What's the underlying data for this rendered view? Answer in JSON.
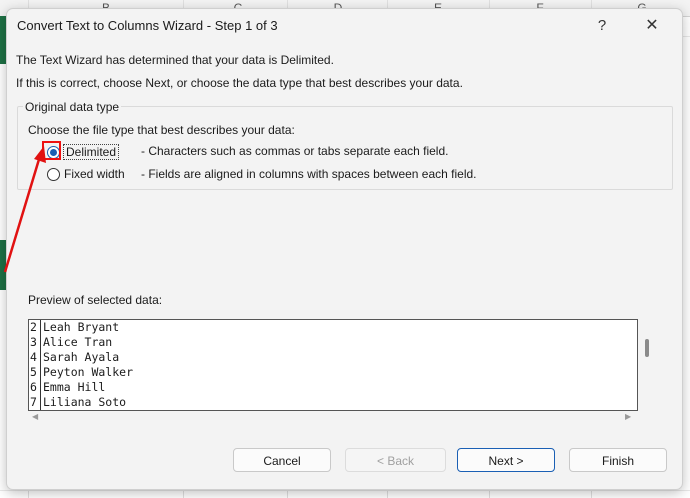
{
  "spreadsheet": {
    "columns": [
      "B",
      "C",
      "D",
      "E",
      "F",
      "G"
    ]
  },
  "dialog": {
    "title": "Convert Text to Columns Wizard - Step 1 of 3",
    "help_label": "?",
    "close_label": "✕",
    "intro_line1": "The Text Wizard has determined that your data is Delimited.",
    "intro_line2": "If this is correct, choose Next, or choose the data type that best describes your data.",
    "group_title": "Original data type",
    "choose_label": "Choose the file type that best describes your data:",
    "options": [
      {
        "label": "Delimited",
        "desc": "- Characters such as commas or tabs separate each field.",
        "checked": true
      },
      {
        "label": "Fixed width",
        "desc": "- Fields are aligned in columns with spaces between each field.",
        "checked": false
      }
    ],
    "preview_label": "Preview of selected data:",
    "preview_rows": [
      {
        "num": "2",
        "text": "Leah Bryant"
      },
      {
        "num": "3",
        "text": "Alice Tran"
      },
      {
        "num": "4",
        "text": "Sarah Ayala"
      },
      {
        "num": "5",
        "text": "Peyton Walker"
      },
      {
        "num": "6",
        "text": "Emma Hill"
      },
      {
        "num": "7",
        "text": "Liliana Soto"
      }
    ],
    "buttons": {
      "cancel": "Cancel",
      "back": "< Back",
      "next": "Next >",
      "finish": "Finish"
    }
  },
  "colors": {
    "accent": "#1a5fb4",
    "annotation": "#e11111",
    "excel_green": "#1e7145"
  }
}
